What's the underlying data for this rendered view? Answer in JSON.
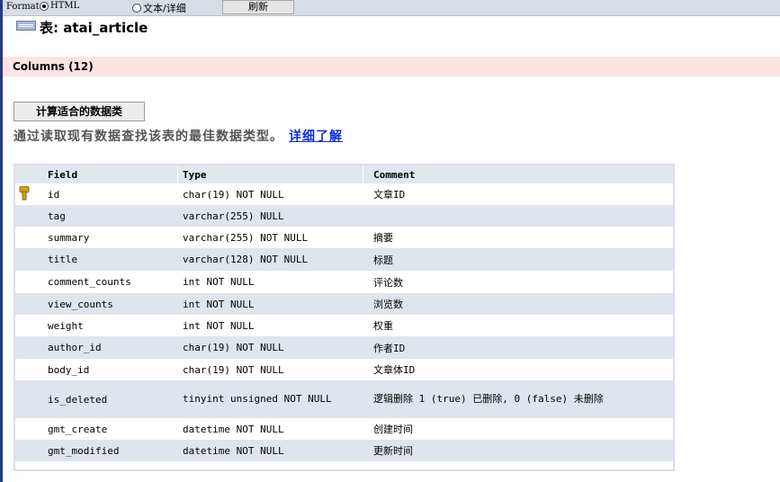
{
  "toolbar": {
    "format_label": "Format:",
    "options": [
      {
        "label": "HTML",
        "selected": true
      },
      {
        "label": "文本/详细",
        "selected": false
      }
    ],
    "refresh_label": "刷新"
  },
  "page": {
    "title": "表: atai_article",
    "columns_header": "Columns (12)",
    "calc_button_label": "计算适合的数据类",
    "description": "通过读取现有数据查找该表的最佳数据类型。",
    "learn_more_link": "详细了解"
  },
  "table": {
    "headers": [
      "Field",
      "Type",
      "Comment"
    ],
    "rows": [
      {
        "field": "id",
        "type": "char(19) NOT NULL",
        "comment": "文章ID",
        "primary_key": true
      },
      {
        "field": "tag",
        "type": "varchar(255) NULL",
        "comment": ""
      },
      {
        "field": "summary",
        "type": "varchar(255) NOT NULL",
        "comment": "摘要"
      },
      {
        "field": "title",
        "type": "varchar(128) NOT NULL",
        "comment": "标题"
      },
      {
        "field": "comment_counts",
        "type": "int NOT NULL",
        "comment": "评论数"
      },
      {
        "field": "view_counts",
        "type": "int NOT NULL",
        "comment": "浏览数"
      },
      {
        "field": "weight",
        "type": "int NOT NULL",
        "comment": "权重"
      },
      {
        "field": "author_id",
        "type": "char(19) NOT NULL",
        "comment": "作者ID"
      },
      {
        "field": "body_id",
        "type": "char(19) NOT NULL",
        "comment": "文章体ID"
      },
      {
        "field": "is_deleted",
        "type": "tinyint unsigned NOT NULL",
        "comment": "逻辑删除 1 (true) 已删除, 0 (false) 未删除"
      },
      {
        "field": "gmt_create",
        "type": "datetime NOT NULL",
        "comment": "创建时间"
      },
      {
        "field": "gmt_modified",
        "type": "datetime NOT NULL",
        "comment": "更新时间"
      }
    ]
  },
  "icons": {
    "primary_key": "key-icon",
    "table": "table-icon"
  },
  "colors": {
    "columns_header_bg": "#fde3e3",
    "link": "#0a2ed8",
    "row_alt": "#dfe5ec",
    "key": "#d4a017"
  }
}
